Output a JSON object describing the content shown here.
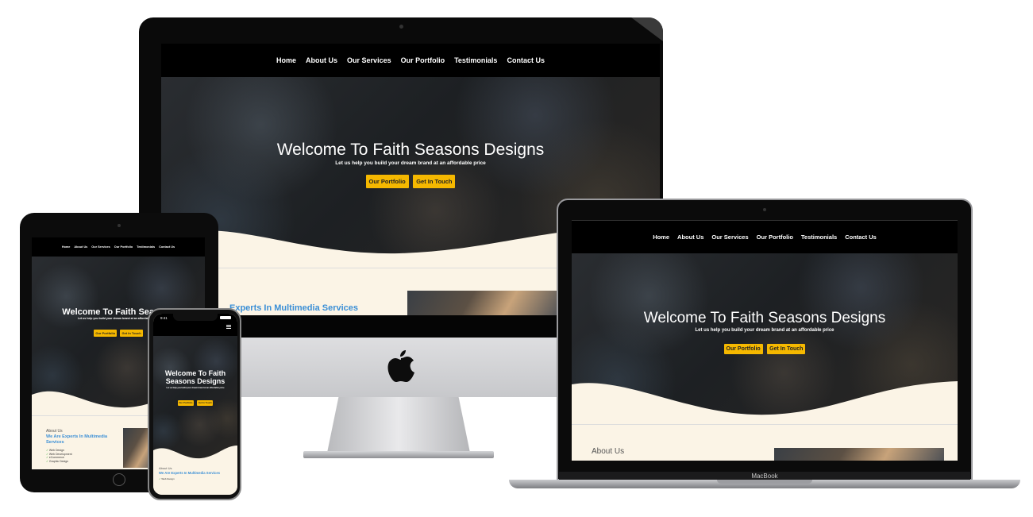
{
  "site": {
    "nav": [
      "Home",
      "About Us",
      "Our Services",
      "Our Portfolio",
      "Testimonials",
      "Contact Us"
    ],
    "hero_title": "Welcome To Faith Seasons Designs",
    "hero_title_mobile": "Welcome To Faith Seasons Designs",
    "hero_subtitle": "Let us help you build your dream brand at an affordable price",
    "btn_portfolio": "Our Portfolio",
    "btn_contact": "Get In Touch",
    "about_label": "About Us",
    "about_title": "We Are Experts In Multimedia Services",
    "services": [
      "Web Design",
      "Web Development",
      "eCommerce",
      "Graphic Design"
    ]
  },
  "imac": {
    "title_partial": "Us",
    "about_partial": "Experts In Multimedia Services"
  },
  "ipad": {
    "hero_title_partial": "Welcome To Faith Seasons"
  },
  "iphone": {
    "time": "9:41",
    "menu_icon": "hamburger-icon"
  },
  "macbook": {
    "brand": "MacBook"
  },
  "colors": {
    "accent_button": "#f5b800",
    "about_title": "#3b8fd6",
    "cream": "#fbf4e6"
  }
}
